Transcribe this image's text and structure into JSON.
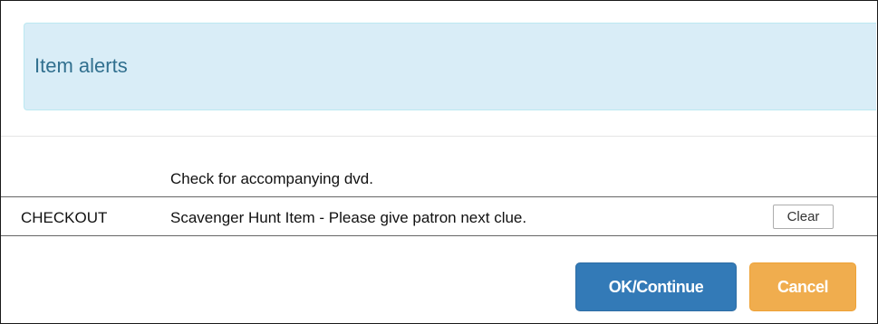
{
  "dialog": {
    "title": "Item alerts",
    "alerts": [
      {
        "type": "",
        "message": "Check for accompanying dvd."
      },
      {
        "type": "CHECKOUT",
        "message": "Scavenger Hunt Item - Please give patron next clue.",
        "clear_label": "Clear"
      }
    ],
    "ok_label": "OK/Continue",
    "cancel_label": "Cancel"
  },
  "colors": {
    "header_bg": "#d9edf7",
    "header_text": "#31708f",
    "ok_button": "#337ab7",
    "cancel_button": "#f0ad4e"
  }
}
